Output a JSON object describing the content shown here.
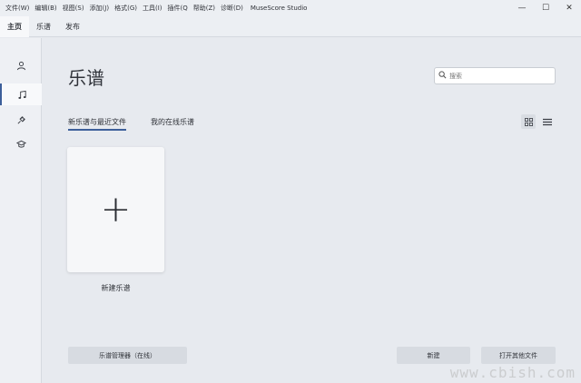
{
  "menubar": {
    "items": [
      "文件(W)",
      "编辑(B)",
      "视图(S)",
      "添加(J)",
      "格式(G)",
      "工具(I)",
      "插件(Q",
      "帮助(Z)",
      "诊断(D)"
    ],
    "app_title": "MuseScore Studio"
  },
  "window_controls": {
    "minimize": "—",
    "maximize": "☐",
    "close": "✕"
  },
  "tabs": [
    "主页",
    "乐谱",
    "发布"
  ],
  "rail": {
    "icons": [
      "person-icon",
      "music-note-icon",
      "plugin-icon",
      "learn-icon"
    ]
  },
  "main": {
    "title": "乐谱",
    "search_placeholder": "搜索",
    "subtabs": [
      "新乐谱与最近文件",
      "我的在线乐谱"
    ],
    "new_card": {
      "plus": "+",
      "label": "新建乐谱"
    }
  },
  "buttons": {
    "manager": "乐谱管理器（在线）",
    "new": "新建",
    "open_other": "打开其他文件"
  },
  "colors": {
    "accent": "#3d5f9a",
    "background": "#e7eaef"
  },
  "watermark": "www.cbish.com"
}
